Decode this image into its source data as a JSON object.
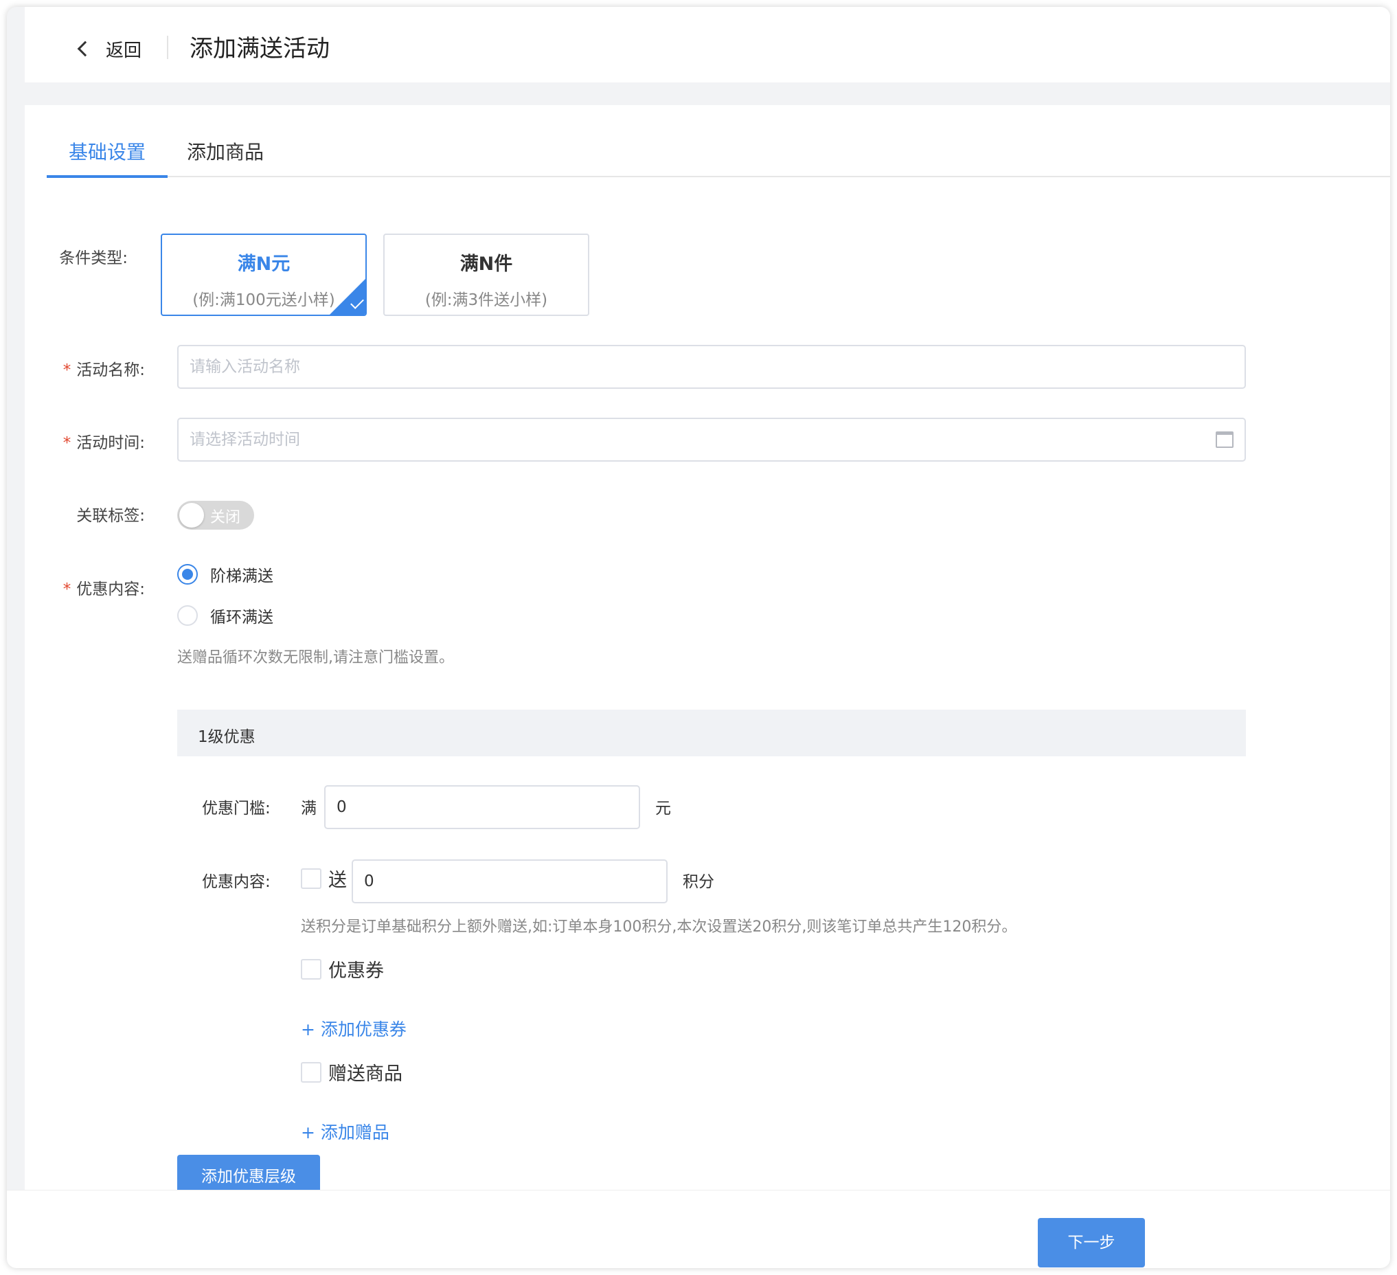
{
  "header": {
    "back_label": "返回",
    "title": "添加满送活动"
  },
  "tabs": [
    {
      "label": "基础设置",
      "active": true
    },
    {
      "label": "添加商品",
      "active": false
    }
  ],
  "form": {
    "condition_type": {
      "label": "条件类型:",
      "options": [
        {
          "title": "满N元",
          "subtitle": "(例:满100元送小样)",
          "selected": true
        },
        {
          "title": "满N件",
          "subtitle": "(例:满3件送小样)",
          "selected": false
        }
      ]
    },
    "activity_name": {
      "label": "活动名称:",
      "required": "*",
      "placeholder": "请输入活动名称"
    },
    "activity_time": {
      "label": "活动时间:",
      "required": "*",
      "placeholder": "请选择活动时间",
      "icon": "calendar-icon"
    },
    "related_tag": {
      "label": "关联标签:",
      "toggle_text": "关闭",
      "on": false
    },
    "discount_content": {
      "label": "优惠内容:",
      "required": "*",
      "options": [
        {
          "label": "阶梯满送",
          "checked": true
        },
        {
          "label": "循环满送",
          "checked": false
        }
      ],
      "hint": "送赠品循环次数无限制,请注意门槛设置。"
    },
    "level": {
      "title": "1级优惠",
      "threshold_label": "优惠门槛:",
      "threshold_prefix": "满",
      "threshold_value": "0",
      "threshold_unit": "元",
      "content_label": "优惠内容:",
      "points_label": "送",
      "points_value": "0",
      "points_unit": "积分",
      "points_hint": "送积分是订单基础积分上额外赠送,如:订单本身100积分,本次设置送20积分,则该笔订单总共产生120积分。",
      "coupon_label": "优惠券",
      "add_coupon": "+ 添加优惠券",
      "gift_label": "赠送商品",
      "add_gift": "+ 添加赠品"
    },
    "add_level_button": "添加优惠层级"
  },
  "footer": {
    "next_button": "下一步"
  },
  "colors": {
    "accent": "#3a86e8",
    "required": "#e2472f",
    "page_bg": "#f2f3f5"
  }
}
